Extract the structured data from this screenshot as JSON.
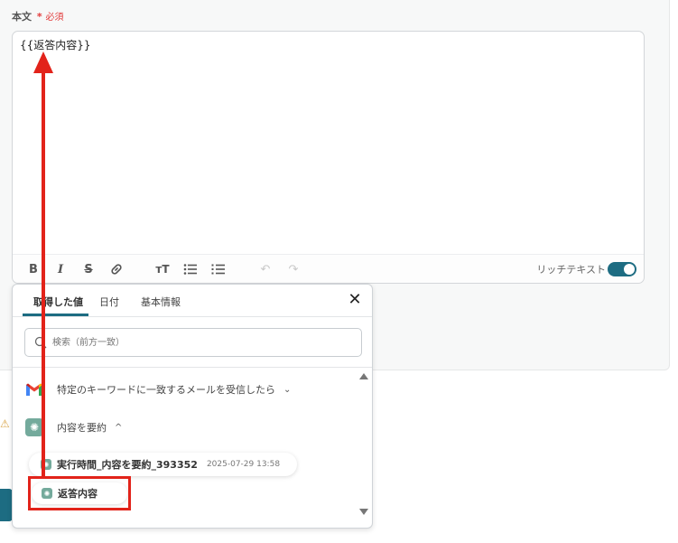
{
  "field": {
    "label": "本文",
    "required_mark": "*",
    "required_text": "必須",
    "value": "{{返答内容}}"
  },
  "toolbar": {
    "rich_text_label": "リッチテキスト",
    "rich_text_enabled": true,
    "icons": [
      "bold-icon",
      "italic-icon",
      "strikethrough-icon",
      "link-icon",
      "text-size-icon",
      "bullet-list-icon",
      "numbered-list-icon",
      "undo-icon",
      "redo-icon"
    ]
  },
  "popup": {
    "tabs": [
      {
        "label": "取得した値",
        "active": true
      },
      {
        "label": "日付",
        "active": false
      },
      {
        "label": "基本情報",
        "active": false
      }
    ],
    "search_placeholder": "検索（前方一致）",
    "tree": {
      "trigger": {
        "label": "特定のキーワードに一致するメールを受信したら",
        "icon": "gmail-icon",
        "expanded": false
      },
      "operation": {
        "label": "内容を要約",
        "icon": "chatgpt-icon",
        "expanded": true
      },
      "step": {
        "label": "実行時間_内容を要約_393352",
        "timestamp": "2025-07-29 13:58"
      },
      "value": {
        "label": "返答内容"
      }
    }
  },
  "colors": {
    "accent": "#1d6c82",
    "required": "#e23b3b",
    "annotation": "#e2231a",
    "chatgpt": "#74aa9c"
  }
}
